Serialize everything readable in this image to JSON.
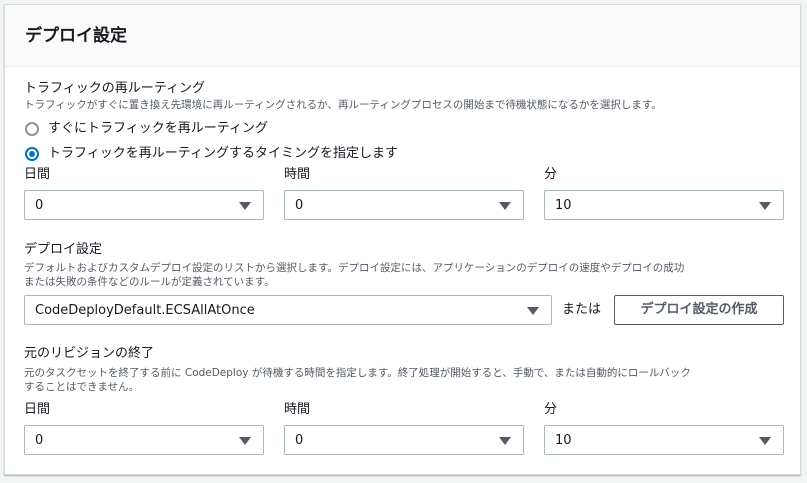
{
  "panel": {
    "title": "デプロイ設定"
  },
  "traffic_rerouting": {
    "label": "トラフィックの再ルーティング",
    "description": "トラフィックがすぐに置き換え先環境に再ルーティングされるか、再ルーティングプロセスの開始まで待機状態になるかを選択します。",
    "options": [
      {
        "label": "すぐにトラフィックを再ルーティング",
        "checked": false
      },
      {
        "label": "トラフィックを再ルーティングするタイミングを指定します",
        "checked": true
      }
    ],
    "timing": {
      "days": {
        "label": "日間",
        "value": "0"
      },
      "hours": {
        "label": "時間",
        "value": "0"
      },
      "minutes": {
        "label": "分",
        "value": "10"
      }
    }
  },
  "deployment_config": {
    "label": "デプロイ設定",
    "description_line1": "デフォルトおよびカスタムデプロイ設定のリストから選択します。デプロイ設定には、アプリケーションのデプロイの速度やデプロイの成功",
    "description_line2": "または失敗の条件などのルールが定義されています。",
    "selected": "CodeDeployDefault.ECSAllAtOnce",
    "or_text": "または",
    "create_button": "デプロイ設定の作成"
  },
  "original_revision_termination": {
    "label": "元のリビジョンの終了",
    "description_line1": "元のタスクセットを終了する前に CodeDeploy が待機する時間を指定します。終了処理が開始すると、手動で、または自動的にロールバック",
    "description_line2": "することはできません。",
    "timing": {
      "days": {
        "label": "日間",
        "value": "0"
      },
      "hours": {
        "label": "時間",
        "value": "0"
      },
      "minutes": {
        "label": "分",
        "value": "10"
      }
    }
  },
  "colors": {
    "accent": "#0073bb",
    "border": "#aab7b8",
    "text": "#16191f",
    "secondary_text": "#545b64"
  }
}
